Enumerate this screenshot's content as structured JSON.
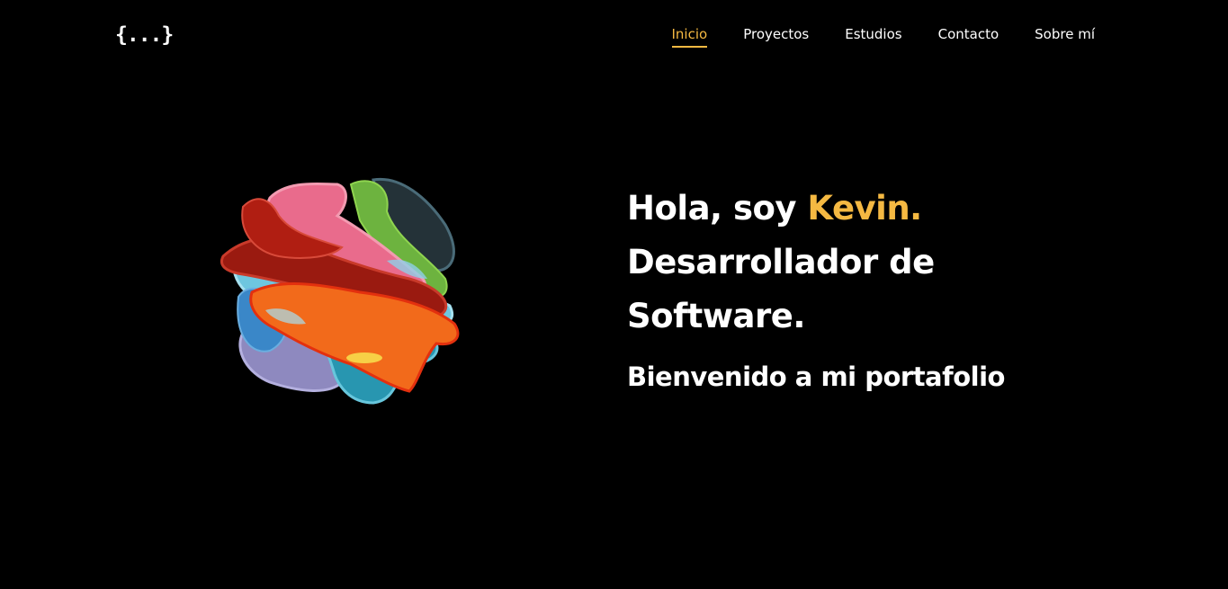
{
  "header": {
    "logo_text": "{...}",
    "nav": [
      {
        "label": "Inicio",
        "active": true
      },
      {
        "label": "Proyectos",
        "active": false
      },
      {
        "label": "Estudios",
        "active": false
      },
      {
        "label": "Contacto",
        "active": false
      },
      {
        "label": "Sobre mí",
        "active": false
      }
    ]
  },
  "hero": {
    "greeting": "Hola, soy ",
    "name": "Kevin.",
    "role_line1": "Desarrollador de",
    "role_line2": "Software.",
    "welcome": "Bienvenido a mi portafolio",
    "image_icon": "abstract-color-sphere"
  },
  "colors": {
    "background": "#000000",
    "text": "#ffffff",
    "accent": "#f5b942"
  }
}
